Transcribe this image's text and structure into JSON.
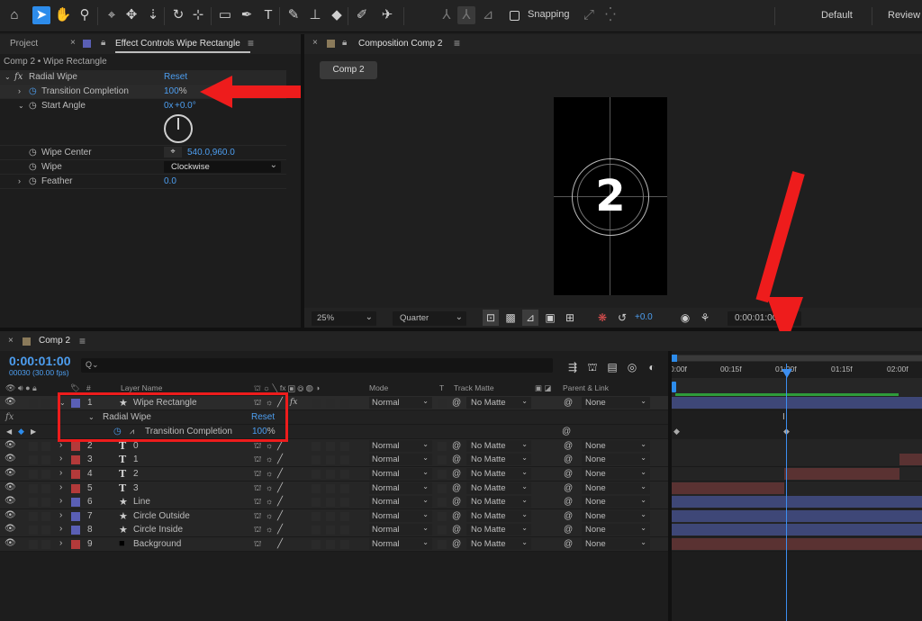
{
  "toolbar": {
    "snapping_label": "Snapping",
    "workspaces": [
      "Default",
      "Review"
    ]
  },
  "left_panel": {
    "tab_project": "Project",
    "tab_effect_controls": "Effect Controls Wipe Rectangle",
    "breadcrumb": "Comp 2 • Wipe Rectangle",
    "effect_name": "Radial Wipe",
    "effect_reset": "Reset",
    "properties": {
      "transition_completion": {
        "label": "Transition Completion",
        "value": "100",
        "unit": "%"
      },
      "start_angle": {
        "label": "Start Angle",
        "value_rev": "0x",
        "value_deg": "+0.0°"
      },
      "wipe_center": {
        "label": "Wipe Center",
        "value": "540.0,960.0"
      },
      "wipe": {
        "label": "Wipe",
        "value": "Clockwise"
      },
      "feather": {
        "label": "Feather",
        "value": "0.0"
      }
    }
  },
  "comp_panel": {
    "tab_label": "Composition Comp 2",
    "comp_button": "Comp 2",
    "canvas_number": "2",
    "zoom": "25%",
    "resolution": "Quarter",
    "exposure": "+0.0",
    "timecode": "0:00:01:00"
  },
  "timeline": {
    "tab_label": "Comp 2",
    "timecode": "0:00:01:00",
    "fps_info": "00030 (30.00 fps)",
    "search_placeholder": "Q⌄",
    "headers": {
      "hash": "#",
      "layer_name": "Layer Name",
      "mode": "Mode",
      "t": "T",
      "track_matte": "Track Matte",
      "parent": "Parent & Link"
    },
    "ruler": [
      "0:00f",
      "00:15f",
      "01:00f",
      "01:15f",
      "02:00f"
    ],
    "sub_effect": {
      "name": "Radial Wipe",
      "reset": "Reset",
      "prop": "Transition Completion",
      "value": "100",
      "unit": "%"
    },
    "layers": [
      {
        "num": "1",
        "type": "star",
        "name": "Wipe Rectangle",
        "color": "#5a5fb5",
        "mode": "Normal",
        "matte": "No Matte",
        "parent": "None",
        "bar_color": "#3e4777",
        "bar_start": 0,
        "bar_end": 1,
        "expanded": true
      },
      {
        "num": "2",
        "type": "T",
        "name": "0",
        "color": "#b33a3a",
        "mode": "Normal",
        "matte": "No Matte",
        "parent": "None",
        "bar_color": "#5a3232",
        "bar_start": 0,
        "bar_end": 0
      },
      {
        "num": "3",
        "type": "T",
        "name": "1",
        "color": "#b33a3a",
        "mode": "Normal",
        "matte": "No Matte",
        "parent": "None",
        "bar_color": "#5a3232",
        "bar_start": 0.91,
        "bar_end": 1
      },
      {
        "num": "4",
        "type": "T",
        "name": "2",
        "color": "#b33a3a",
        "mode": "Normal",
        "matte": "No Matte",
        "parent": "None",
        "bar_color": "#5a3232",
        "bar_start": 0.45,
        "bar_end": 0.91
      },
      {
        "num": "5",
        "type": "T",
        "name": "3",
        "color": "#b33a3a",
        "mode": "Normal",
        "matte": "No Matte",
        "parent": "None",
        "bar_color": "#5a3232",
        "bar_start": 0,
        "bar_end": 0.45
      },
      {
        "num": "6",
        "type": "star",
        "name": "Line",
        "color": "#5a5fb5",
        "mode": "Normal",
        "matte": "No Matte",
        "parent": "None",
        "bar_color": "#3e4777",
        "bar_start": 0,
        "bar_end": 1
      },
      {
        "num": "7",
        "type": "star",
        "name": "Circle Outside",
        "color": "#5a5fb5",
        "mode": "Normal",
        "matte": "No Matte",
        "parent": "None",
        "bar_color": "#3e4777",
        "bar_start": 0,
        "bar_end": 1
      },
      {
        "num": "8",
        "type": "star",
        "name": "Circle Inside",
        "color": "#5a5fb5",
        "mode": "Normal",
        "matte": "No Matte",
        "parent": "None",
        "bar_color": "#3e4777",
        "bar_start": 0,
        "bar_end": 1
      },
      {
        "num": "9",
        "type": "solid",
        "name": "Background",
        "color": "#b33a3a",
        "mode": "Normal",
        "matte": "No Matte",
        "parent": "None",
        "bar_color": "#5a3232",
        "bar_start": 0,
        "bar_end": 1
      }
    ]
  },
  "colors": {
    "accent_blue": "#2d8ceb",
    "value_blue": "#4d9ef0",
    "annotation_red": "#ee1c1c",
    "label_blue": "#5a5fb5",
    "label_red": "#b33a3a"
  }
}
